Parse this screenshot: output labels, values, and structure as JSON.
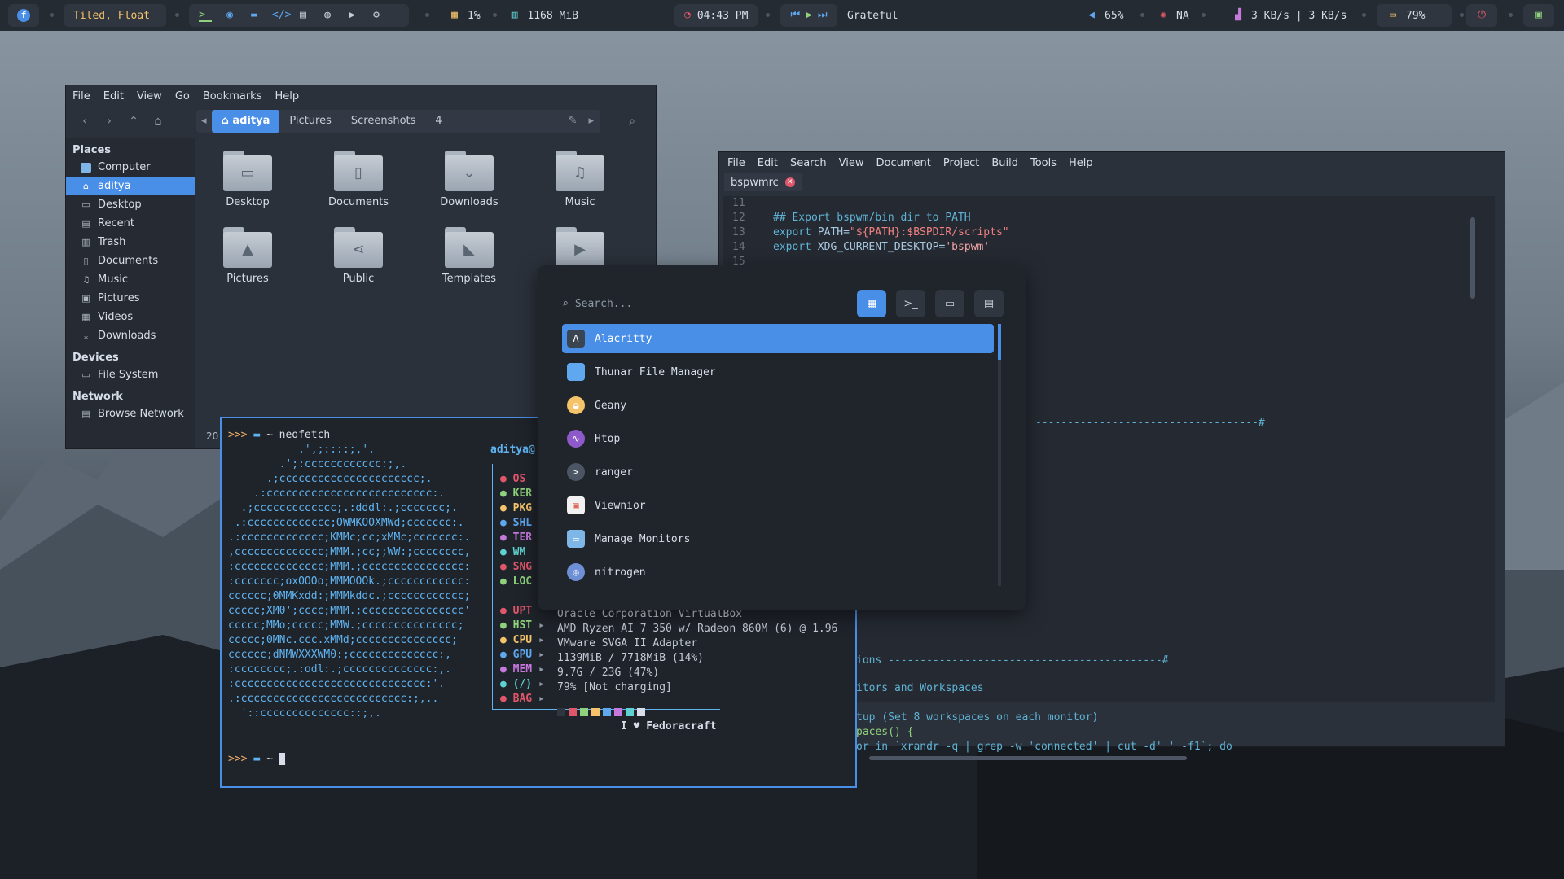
{
  "topbar": {
    "layout": "Tiled, Float",
    "cpu": "1%",
    "memory": "1168 MiB",
    "clock": "04:43 PM",
    "song": "Grateful",
    "volume": "65%",
    "network_status": "NA",
    "net_speed": "3 KB/s | 3 KB/s",
    "battery": "79%",
    "icons": [
      "fedora-icon",
      "terminal-icon",
      "firefox-icon",
      "folder-icon",
      "code-icon",
      "notes-icon",
      "chat-icon",
      "youtube-icon",
      "settings-icon"
    ],
    "accent": "#4a8fe7"
  },
  "file_manager": {
    "menu": [
      "File",
      "Edit",
      "View",
      "Go",
      "Bookmarks",
      "Help"
    ],
    "path": [
      "aditya",
      "Pictures",
      "Screenshots",
      "4"
    ],
    "places_header": "Places",
    "places": [
      {
        "label": "Computer",
        "icon": "computer-icon"
      },
      {
        "label": "aditya",
        "icon": "home-icon"
      },
      {
        "label": "Desktop",
        "icon": "desktop-icon"
      },
      {
        "label": "Recent",
        "icon": "recent-icon"
      },
      {
        "label": "Trash",
        "icon": "trash-icon"
      },
      {
        "label": "Documents",
        "icon": "documents-icon"
      },
      {
        "label": "Music",
        "icon": "music-icon"
      },
      {
        "label": "Pictures",
        "icon": "pictures-icon"
      },
      {
        "label": "Videos",
        "icon": "videos-icon"
      },
      {
        "label": "Downloads",
        "icon": "downloads-icon"
      }
    ],
    "devices_header": "Devices",
    "devices": [
      {
        "label": "File System",
        "icon": "drive-icon"
      }
    ],
    "network_header": "Network",
    "network": [
      {
        "label": "Browse Network",
        "icon": "network-icon"
      }
    ],
    "files": [
      "Desktop",
      "Documents",
      "Downloads",
      "Music",
      "Pictures",
      "Public",
      "Templates"
    ],
    "status_partial": "20"
  },
  "geany": {
    "menu": [
      "File",
      "Edit",
      "Search",
      "View",
      "Document",
      "Project",
      "Build",
      "Tools",
      "Help"
    ],
    "tab": "bspwmrc",
    "line_numbers": [
      "11",
      "12",
      "13",
      "14",
      "15"
    ],
    "code": {
      "l12": "## Export bspwm/bin dir to PATH",
      "l13a": "export ",
      "l13b": "PATH=",
      "l13c": "\"${PATH}:$BSPDIR/scripts\"",
      "l14a": "export ",
      "l14b": "XDG_CURRENT_DESKTOP=",
      "l14c": "'bspwm'",
      "dash1": "-----------------------------------#",
      "dash2": "ions -------------------------------------------#",
      "monitors": "itors and Workspaces",
      "setup": "tup (Set 8 workspaces on each monitor)",
      "paces": "paces() {",
      "loop": "or in `xrandr -q | grep -w 'connected' | cut -d' ' -f1`; do"
    }
  },
  "terminal": {
    "prompt": ">>>",
    "cwd": "~",
    "command": "neofetch",
    "user": "aditya@",
    "ascii": [
      "           .',;::::;,'.",
      "        .';:cccccccccccc:;,.",
      "      .;cccccccccccccccccccccc;.",
      "    .:cccccccccccccccccccccccccc:.",
      "  .;ccccccccccccc;.:dddl:.;ccccccc;.",
      " .:ccccccccccccc;OWMKOOXMWd;ccccccc:.",
      ".:ccccccccccccc;KMMc;cc;xMMc;ccccccc:.",
      ",cccccccccccccc;MMM.;cc;;WW:;cccccccc,",
      ":cccccccccccccc;MMM.;cccccccccccccccc:",
      ":ccccccc;oxOOOo;MMMOOOk.;cccccccccccc:",
      "cccccc;0MMKxdd:;MMMkddc.;cccccccccccc;",
      "ccccc;XM0';cccc;MMM.;cccccccccccccccc'",
      "ccccc;MMo;ccccc;MMW.;ccccccccccccccc;",
      "ccccc;0MNc.ccc.xMMd;ccccccccccccccc;",
      "cccccc;dNMWXXXWM0:;cccccccccccccc:,",
      ":cccccccc;.:odl:.;cccccccccccccc:,.",
      ":cccccccccccccccccccccccccccccc:'.",
      ".:cccccccccccccccccccccccccc:;,..",
      "  '::cccccccccccccc::;,."
    ],
    "keys": [
      "OS",
      "KER",
      "PKG",
      "SHL",
      "TER",
      "WM",
      "SNG",
      "LOC",
      "UPT",
      "HST",
      "CPU",
      "GPU",
      "MEM",
      "(/)",
      "BAG"
    ],
    "values": {
      "UPT": "",
      "HST": "Oracle Corporation VirtualBox",
      "CPU": "AMD Ryzen AI 7 350 w/ Radeon 860M (6) @ 1.96",
      "GPU": "VMware SVGA II Adapter",
      "MEM": "1139MiB / 7718MiB (14%)",
      "(/)": "9.7G / 23G (47%)",
      "BAG": "79% [Not charging]"
    },
    "footer": "I ♥ Fedoracraft",
    "palette": [
      "#2f3640",
      "#e0566a",
      "#8fd17c",
      "#f4c36a",
      "#5fa8f0",
      "#c678dd",
      "#5fd1d1",
      "#d8dee9"
    ]
  },
  "launcher": {
    "placeholder": "Search...",
    "modes": [
      "apps-mode-icon",
      "run-mode-icon",
      "files-mode-icon",
      "windows-mode-icon"
    ],
    "apps": [
      {
        "label": "Alacritty",
        "icon": "alacritty-icon",
        "color": "#3b4451"
      },
      {
        "label": "Thunar File Manager",
        "icon": "thunar-icon",
        "color": "#5fa8f0"
      },
      {
        "label": "Geany",
        "icon": "geany-icon",
        "color": "#f4c36a"
      },
      {
        "label": "Htop",
        "icon": "htop-icon",
        "color": "#8e5ac9"
      },
      {
        "label": "ranger",
        "icon": "ranger-icon",
        "color": "#4c5563"
      },
      {
        "label": "Viewnior",
        "icon": "viewnior-icon",
        "color": "#e06a5a"
      },
      {
        "label": "Manage Monitors",
        "icon": "monitor-icon",
        "color": "#7fb6e8"
      },
      {
        "label": "nitrogen",
        "icon": "nitrogen-icon",
        "color": "#6e8fd6"
      }
    ]
  }
}
